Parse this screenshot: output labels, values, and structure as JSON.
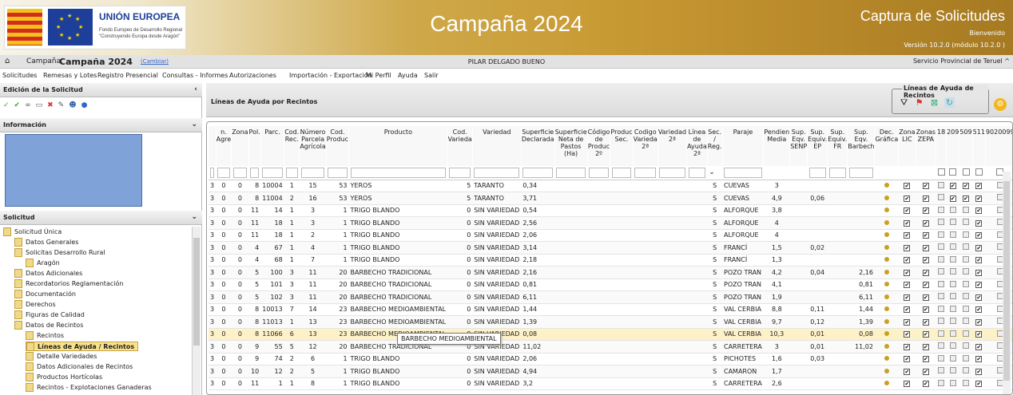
{
  "banner": {
    "eu_title": "UNIÓN EUROPEA",
    "eu_subtitle": "Fondo Europeo de Desarrollo Regional \"Construyendo Europa desde Aragón\"",
    "campaign_title": "Campaña 2024",
    "app_title": "Captura de Solicitudes",
    "welcome": "Bienvenido",
    "version": "Versión 10.2.0 (módulo 10.2.0 )"
  },
  "infobar": {
    "campaign_label": "Campaña:",
    "campaign_value": "Campaña 2024",
    "change_link": "(Cambiar)",
    "user": "PILAR DELGADO BUENO",
    "service": "Servicio Provincial de Teruel ^"
  },
  "menu": [
    "Solicitudes",
    "Remesas y Lotes",
    "Registro Presencial",
    "Consultas - Informes",
    "Autorizaciones",
    "Importación - Exportación",
    "Mi Perfil",
    "Ayuda",
    "Salir"
  ],
  "left": {
    "edicion_title": "Edición de la Solicitud",
    "informacion_title": "Información",
    "solicitud_title": "Solicitud",
    "tree": [
      {
        "label": "Solicitud Única",
        "level": 0
      },
      {
        "label": "Datos Generales",
        "level": 1
      },
      {
        "label": "Solicitas Desarrollo Rural",
        "level": 1
      },
      {
        "label": "Aragón",
        "level": 2
      },
      {
        "label": "Datos Adicionales",
        "level": 1
      },
      {
        "label": "Recordatorios Reglamentación",
        "level": 1
      },
      {
        "label": "Documentación",
        "level": 1
      },
      {
        "label": "Derechos",
        "level": 1
      },
      {
        "label": "Figuras de Calidad",
        "level": 1
      },
      {
        "label": "Datos de Recintos",
        "level": 1
      },
      {
        "label": "Recintos",
        "level": 2
      },
      {
        "label": "Líneas de Ayuda / Recintos",
        "level": 2,
        "selected": true
      },
      {
        "label": "Detalle Variedades",
        "level": 2
      },
      {
        "label": "Datos Adicionales de Recintos",
        "level": 2
      },
      {
        "label": "Productos Hortícolas",
        "level": 2
      },
      {
        "label": "Recintos - Explotaciones Ganaderas",
        "level": 2
      }
    ]
  },
  "main": {
    "title": "Líneas de Ayuda por Recintos",
    "ayuda_box_title": "Líneas de Ayuda de Recintos",
    "tooltip": "BARBECHO MEDIOAMBIENTAL",
    "columns": [
      "n. Agre",
      "Zona",
      "Pol.",
      "Parc.",
      "Cod. Rec.",
      "Número Parcela Agrícola",
      "Cod. Produc",
      "Producto",
      "Cod. Varieda",
      "Variedad",
      "Superficie Declarada",
      "Superficie Neta de Pastos (Ha)",
      "Código de Produc 2º",
      "Produc Sec.",
      "Codigo Varieda 2ª",
      "Variedad 2ª",
      "Línea de Ayuda 2ª",
      "Sec. / Reg.",
      "Paraje",
      "Pendien Media",
      "Sup. Eqv. SENP",
      "Sup. Equiv. EP",
      "Sup. Equiv. FR",
      "Sup. Eqv. Barbech",
      "Dec. Gráfica",
      "Zona LIC",
      "Zonas ZEPA",
      "18",
      "209",
      "509",
      "511",
      "9020099"
    ],
    "rows": [
      [
        "3",
        "0",
        "0",
        "8",
        "10004",
        "1",
        "15",
        "53",
        "YEROS",
        "5",
        "TARANTO",
        "0,34",
        "S",
        "CUEVAS",
        "3",
        "",
        "",
        "",
        [
          0,
          1,
          1,
          1,
          0,
          0
        ]
      ],
      [
        "3",
        "0",
        "0",
        "8",
        "11004",
        "2",
        "16",
        "53",
        "YEROS",
        "5",
        "TARANTO",
        "3,71",
        "S",
        "CUEVAS",
        "4,9",
        "0,06",
        "",
        "",
        [
          0,
          1,
          1,
          1,
          0,
          0
        ]
      ],
      [
        "3",
        "0",
        "0",
        "11",
        "14",
        "1",
        "3",
        "1",
        "TRIGO BLANDO",
        "0",
        "SIN VARIEDAD",
        "0,54",
        "S",
        "ALFORQUE",
        "3,8",
        "",
        "",
        "",
        [
          0,
          0,
          0,
          1,
          0,
          0
        ]
      ],
      [
        "3",
        "0",
        "0",
        "11",
        "18",
        "1",
        "3",
        "1",
        "TRIGO BLANDO",
        "0",
        "SIN VARIEDAD",
        "2,56",
        "S",
        "ALFORQUE",
        "4",
        "",
        "",
        "",
        [
          0,
          0,
          0,
          1,
          0,
          0
        ]
      ],
      [
        "3",
        "0",
        "0",
        "11",
        "18",
        "1",
        "2",
        "1",
        "TRIGO BLANDO",
        "0",
        "SIN VARIEDAD",
        "2,06",
        "S",
        "ALFORQUE",
        "4",
        "",
        "",
        "",
        [
          0,
          0,
          0,
          1,
          0,
          0
        ]
      ],
      [
        "3",
        "0",
        "0",
        "4",
        "67",
        "1",
        "4",
        "1",
        "TRIGO BLANDO",
        "0",
        "SIN VARIEDAD",
        "3,14",
        "S",
        "FRANCÍ",
        "1,5",
        "0,02",
        "",
        "",
        [
          0,
          0,
          0,
          1,
          0,
          0
        ]
      ],
      [
        "3",
        "0",
        "0",
        "4",
        "68",
        "1",
        "7",
        "1",
        "TRIGO BLANDO",
        "0",
        "SIN VARIEDAD",
        "2,18",
        "S",
        "FRANCÍ",
        "1,3",
        "",
        "",
        "",
        [
          0,
          0,
          0,
          1,
          0,
          0
        ]
      ],
      [
        "3",
        "0",
        "0",
        "5",
        "100",
        "3",
        "11",
        "20",
        "BARBECHO TRADICIONAL",
        "0",
        "SIN VARIEDAD",
        "2,16",
        "S",
        "POZO TRAN",
        "4,2",
        "0,04",
        "2,16",
        "",
        [
          0,
          0,
          0,
          1,
          0,
          0
        ]
      ],
      [
        "3",
        "0",
        "0",
        "5",
        "101",
        "3",
        "11",
        "20",
        "BARBECHO TRADICIONAL",
        "0",
        "SIN VARIEDAD",
        "0,81",
        "S",
        "POZO TRAN",
        "4,1",
        "",
        "0,81",
        "",
        [
          0,
          0,
          0,
          1,
          0,
          0
        ]
      ],
      [
        "3",
        "0",
        "0",
        "5",
        "102",
        "3",
        "11",
        "20",
        "BARBECHO TRADICIONAL",
        "0",
        "SIN VARIEDAD",
        "6,11",
        "S",
        "POZO TRAN",
        "1,9",
        "",
        "6,11",
        "",
        [
          0,
          0,
          0,
          1,
          0,
          0
        ]
      ],
      [
        "3",
        "0",
        "0",
        "8",
        "10013",
        "7",
        "14",
        "23",
        "BARBECHO MEDIOAMBIENTAL",
        "0",
        "SIN VARIEDAD",
        "1,44",
        "S",
        "VAL CERBIA",
        "8,8",
        "0,11",
        "1,44",
        "",
        [
          0,
          0,
          0,
          1,
          0,
          1
        ]
      ],
      [
        "3",
        "0",
        "0",
        "8",
        "11013",
        "1",
        "13",
        "23",
        "BARBECHO MEDIOAMBIENTAL",
        "0",
        "SIN VARIEDAD",
        "1,39",
        "S",
        "VAL CERBIA",
        "9,7",
        "0,12",
        "1,39",
        "",
        [
          0,
          0,
          0,
          1,
          0,
          1
        ]
      ],
      [
        "3",
        "0",
        "0",
        "8",
        "11066",
        "6",
        "13",
        "23",
        "BARBECHO MEDIOAMBIENTAL",
        "0",
        "SIN VARIEDAD",
        "0,08",
        "S",
        "VAL CERBIA",
        "10,3",
        "0,01",
        "0,08",
        "hl",
        [
          0,
          0,
          0,
          1,
          0,
          1
        ]
      ],
      [
        "3",
        "0",
        "0",
        "9",
        "55",
        "5",
        "12",
        "20",
        "BARBECHO TRADICIONAL",
        "0",
        "SIN VARIEDAD",
        "11,02",
        "S",
        "CARRETERA",
        "3",
        "0,01",
        "11,02",
        "",
        [
          0,
          0,
          0,
          1,
          0,
          0
        ]
      ],
      [
        "3",
        "0",
        "0",
        "9",
        "74",
        "2",
        "6",
        "1",
        "TRIGO BLANDO",
        "0",
        "SIN VARIEDAD",
        "2,06",
        "S",
        "PICHOTES",
        "1,6",
        "0,03",
        "",
        "",
        [
          0,
          0,
          0,
          1,
          0,
          0
        ]
      ],
      [
        "3",
        "0",
        "0",
        "10",
        "12",
        "2",
        "5",
        "1",
        "TRIGO BLANDO",
        "0",
        "SIN VARIEDAD",
        "4,94",
        "S",
        "CAMARON",
        "1,7",
        "",
        "",
        "",
        [
          0,
          0,
          0,
          1,
          0,
          0
        ]
      ],
      [
        "3",
        "0",
        "0",
        "11",
        "1",
        "1",
        "8",
        "1",
        "TRIGO BLANDO",
        "0",
        "SIN VARIEDAD",
        "3,2",
        "S",
        "CARRETERA",
        "2,6",
        "",
        "",
        "",
        [
          0,
          0,
          0,
          1,
          0,
          0
        ]
      ]
    ]
  }
}
